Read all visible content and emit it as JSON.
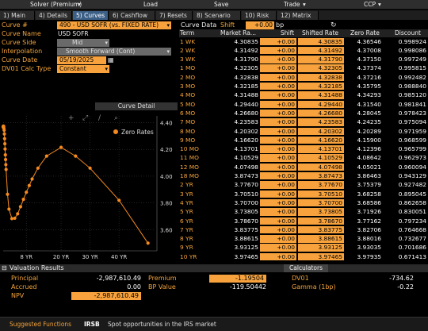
{
  "menu": {
    "solver": "Solver (Premium)",
    "load": "Load",
    "save": "Save",
    "trade": "Trade",
    "ccp": "CCP"
  },
  "tabs": [
    "1) Main",
    "4) Details",
    "5) Curves",
    "6) Cashflow",
    "7) Resets",
    "8) Scenario",
    "10) Risk",
    "12) Matrix"
  ],
  "curve_form": {
    "curve_num_label": "Curve #",
    "curve_num_value": "490 - USD SOFR (vs. FIXED RATE)",
    "curve_name_label": "Curve Name",
    "curve_name_value": "USD SOFR",
    "curve_side_label": "Curve Side",
    "curve_side_value": "Mid",
    "interp_label": "Interpolation",
    "interp_value": "Smooth Forward (Cont)",
    "curve_date_label": "Curve Date",
    "curve_date_value": "05/19/2025",
    "dv01_label": "DV01 Calc Type",
    "dv01_value": "Constant"
  },
  "curve_data": {
    "title": "Curve Data",
    "shift_label": "Shift",
    "shift_value": "+0.00",
    "shift_unit": "bp"
  },
  "chart_detail_label": "Curve Detail",
  "table": {
    "headers": [
      "Term",
      "Market Ra...",
      "Shift",
      "Shifted Rate",
      "Zero Rate",
      "Discount"
    ],
    "rows": [
      [
        "1 WK",
        "4.30835",
        "+0.00",
        "4.30835",
        "4.36546",
        "0.998924"
      ],
      [
        "2 WK",
        "4.31492",
        "+0.00",
        "4.31492",
        "4.37008",
        "0.998086"
      ],
      [
        "3 WK",
        "4.31790",
        "+0.00",
        "4.31790",
        "4.37150",
        "0.997249"
      ],
      [
        "1 MO",
        "4.32305",
        "+0.00",
        "4.32305",
        "4.37374",
        "0.995815"
      ],
      [
        "2 MO",
        "4.32838",
        "+0.00",
        "4.32838",
        "4.37216",
        "0.992482"
      ],
      [
        "3 MO",
        "4.32185",
        "+0.00",
        "4.32185",
        "4.35795",
        "0.988840"
      ],
      [
        "4 MO",
        "4.31488",
        "+0.00",
        "4.31488",
        "4.34293",
        "0.985120"
      ],
      [
        "5 MO",
        "4.29440",
        "+0.00",
        "4.29440",
        "4.31540",
        "0.981841"
      ],
      [
        "6 MO",
        "4.26680",
        "+0.00",
        "4.26680",
        "4.28045",
        "0.978423"
      ],
      [
        "7 MO",
        "4.23583",
        "+0.00",
        "4.23583",
        "4.24235",
        "0.975094"
      ],
      [
        "8 MO",
        "4.20302",
        "+0.00",
        "4.20302",
        "4.20289",
        "0.971959"
      ],
      [
        "9 MO",
        "4.16620",
        "+0.00",
        "4.16620",
        "4.15900",
        "0.968599"
      ],
      [
        "10 MO",
        "4.13701",
        "+0.00",
        "4.13701",
        "4.12396",
        "0.965799"
      ],
      [
        "11 MO",
        "4.10529",
        "+0.00",
        "4.10529",
        "4.08642",
        "0.962973"
      ],
      [
        "12 MO",
        "4.07498",
        "+0.00",
        "4.07498",
        "4.05021",
        "0.960094"
      ],
      [
        "18 MO",
        "3.87473",
        "+0.00",
        "3.87473",
        "3.86463",
        "0.943129"
      ],
      [
        "2 YR",
        "3.77670",
        "+0.00",
        "3.77670",
        "3.75379",
        "0.927482"
      ],
      [
        "3 YR",
        "3.70510",
        "+0.00",
        "3.70510",
        "3.68258",
        "0.895045"
      ],
      [
        "4 YR",
        "3.70700",
        "+0.00",
        "3.70700",
        "3.68586",
        "0.862658"
      ],
      [
        "5 YR",
        "3.73805",
        "+0.00",
        "3.73805",
        "3.71926",
        "0.830051"
      ],
      [
        "6 YR",
        "3.78670",
        "+0.00",
        "3.78670",
        "3.77162",
        "0.797234"
      ],
      [
        "7 YR",
        "3.83775",
        "+0.00",
        "3.83775",
        "3.82706",
        "0.764668"
      ],
      [
        "8 YR",
        "3.88615",
        "+0.00",
        "3.88615",
        "3.88016",
        "0.732677"
      ],
      [
        "9 YR",
        "3.93125",
        "+0.00",
        "3.93125",
        "3.93035",
        "0.701686"
      ],
      [
        "10 YR",
        "3.97465",
        "+0.00",
        "3.97465",
        "3.97935",
        "0.671413"
      ]
    ]
  },
  "chart_data": {
    "type": "scatter",
    "series": [
      {
        "name": "Zero Rates",
        "x": [
          0.019,
          0.038,
          0.058,
          0.083,
          0.167,
          0.25,
          0.333,
          0.417,
          0.5,
          0.583,
          0.667,
          0.75,
          0.833,
          0.917,
          1,
          1.5,
          2,
          3,
          4,
          5,
          6,
          7,
          8,
          9,
          10,
          12,
          15,
          20,
          25,
          30,
          40,
          50
        ],
        "y": [
          4.365,
          4.37,
          4.372,
          4.374,
          4.372,
          4.358,
          4.343,
          4.315,
          4.28,
          4.242,
          4.203,
          4.159,
          4.124,
          4.086,
          4.05,
          3.865,
          3.754,
          3.683,
          3.686,
          3.719,
          3.772,
          3.827,
          3.88,
          3.93,
          3.979,
          4.06,
          4.15,
          4.215,
          4.15,
          4.06,
          3.82,
          3.5
        ]
      }
    ],
    "x_ticks": [
      "8 YR",
      "20 YR",
      "30 YR",
      "40 YR"
    ],
    "y_ticks": [
      "3.60",
      "3.80",
      "4.00",
      "4.20",
      "4.40"
    ],
    "xlim": [
      0,
      52
    ],
    "ylim": [
      3.49,
      4.45
    ],
    "color": "#f58a1f",
    "legend": "top-right"
  },
  "valuation": {
    "title": "Valuation Results",
    "calculators_label": "Calculators",
    "principal_label": "Principal",
    "principal_value": "-2,987,610.49",
    "accrued_label": "Accrued",
    "accrued_value": "0.00",
    "npv_label": "NPV",
    "npv_value": "-2,987,610.49",
    "premium_label": "Premium",
    "premium_value": "-1.19504",
    "bp_value_label": "BP Value",
    "bp_value_value": "-119.50442",
    "dv01_label": "DV01",
    "dv01_value": "-734.62",
    "gamma_label": "Gamma (1bp)",
    "gamma_value": "-0.22"
  },
  "footer": {
    "suggested": "Suggested Functions",
    "code": "IRSB",
    "desc": "Spot opportunities in the IRS market"
  },
  "colors": {
    "accent": "#f7a23c",
    "label": "#f3a33a",
    "tab_active": "#3b5f86"
  }
}
